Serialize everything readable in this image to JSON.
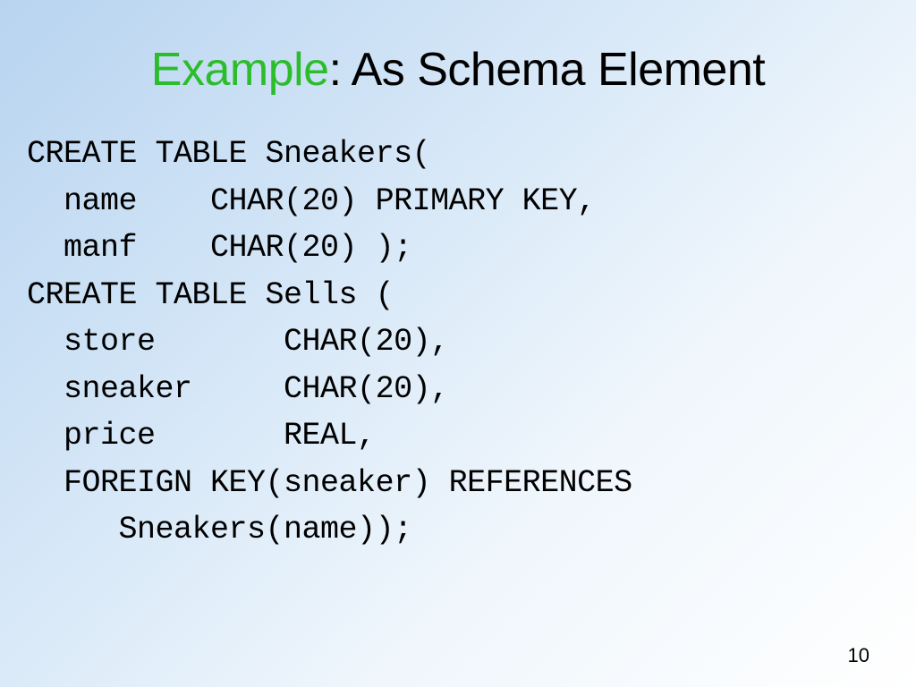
{
  "title": {
    "highlight": "Example",
    "rest": ": As Schema Element"
  },
  "code": {
    "line1": "CREATE TABLE Sneakers(",
    "line2": "  name    CHAR(20) PRIMARY KEY,",
    "line3": "  manf    CHAR(20) );",
    "line4": "CREATE TABLE Sells (",
    "line5": "  store       CHAR(20),",
    "line6": "  sneaker     CHAR(20),",
    "line7": "  price       REAL,",
    "line8": "  FOREIGN KEY(sneaker) REFERENCES",
    "line9": "     Sneakers(name));"
  },
  "pageNumber": "10"
}
